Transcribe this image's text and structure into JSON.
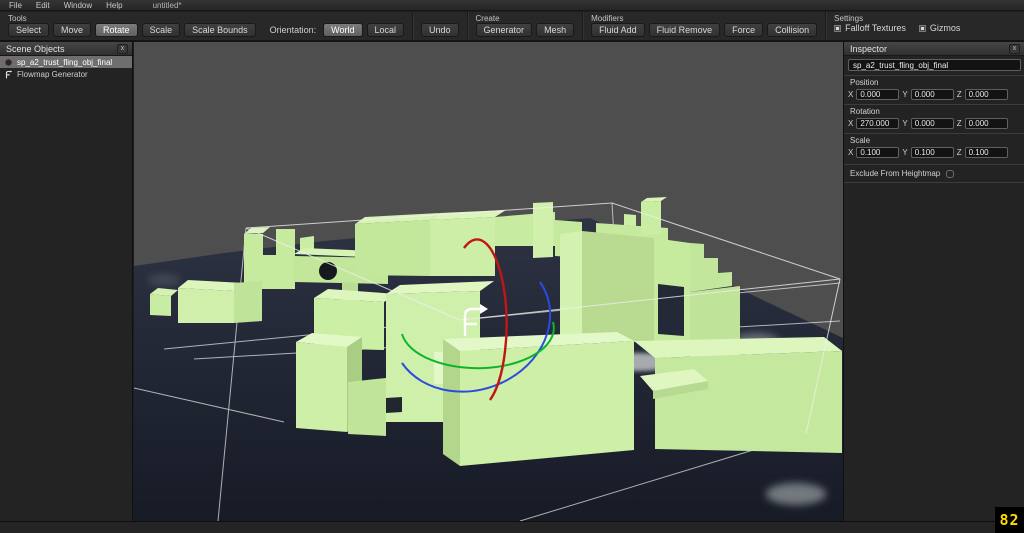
{
  "menu_bar": {
    "items": [
      "File",
      "Edit",
      "Window",
      "Help"
    ],
    "document_title": "untitled*"
  },
  "toolbar": {
    "tools": {
      "label": "Tools",
      "buttons": [
        "Select",
        "Move",
        "Rotate",
        "Scale",
        "Scale Bounds"
      ],
      "active_button": "Rotate",
      "orientation_label": "Orientation:",
      "orientation_options": [
        "World",
        "Local"
      ],
      "active_orientation": "World"
    },
    "undo_label": "Undo",
    "create": {
      "label": "Create",
      "buttons": [
        "Generator",
        "Mesh"
      ]
    },
    "modifiers": {
      "label": "Modifiers",
      "buttons": [
        "Fluid Add",
        "Fluid Remove",
        "Force",
        "Collision"
      ]
    },
    "settings": {
      "label": "Settings",
      "checkboxes": [
        {
          "label": "Falloff Textures",
          "checked": true
        },
        {
          "label": "Gizmos",
          "checked": true
        }
      ]
    }
  },
  "scene_objects_panel": {
    "title": "Scene Objects",
    "close_label": "x",
    "items": [
      {
        "label": "sp_a2_trust_fling_obj_final",
        "selected": true,
        "icon": "mesh-icon"
      },
      {
        "label": "Flowmap Generator",
        "selected": false,
        "icon": "flowmap-icon"
      }
    ]
  },
  "inspector": {
    "title": "Inspector",
    "close_label": "x",
    "name_field": "sp_a2_trust_fling_obj_final",
    "axis_labels": [
      "X",
      "Y",
      "Z"
    ],
    "sections": [
      {
        "label": "Position",
        "x": "0.000",
        "y": "0.000",
        "z": "0.000"
      },
      {
        "label": "Rotation",
        "x": "270.000",
        "y": "0.000",
        "z": "0.000"
      },
      {
        "label": "Scale",
        "x": "0.100",
        "y": "0.100",
        "z": "0.100"
      }
    ],
    "exclude_heightmap_label": "Exclude From Heightmap",
    "exclude_heightmap_checked": false
  },
  "viewport": {
    "fps": "82",
    "selection_color": "#c9eda3",
    "gizmo_colors": {
      "x_axis": "#c01616",
      "y_axis": "#0cb52a",
      "z_axis": "#2b4bdf"
    }
  }
}
